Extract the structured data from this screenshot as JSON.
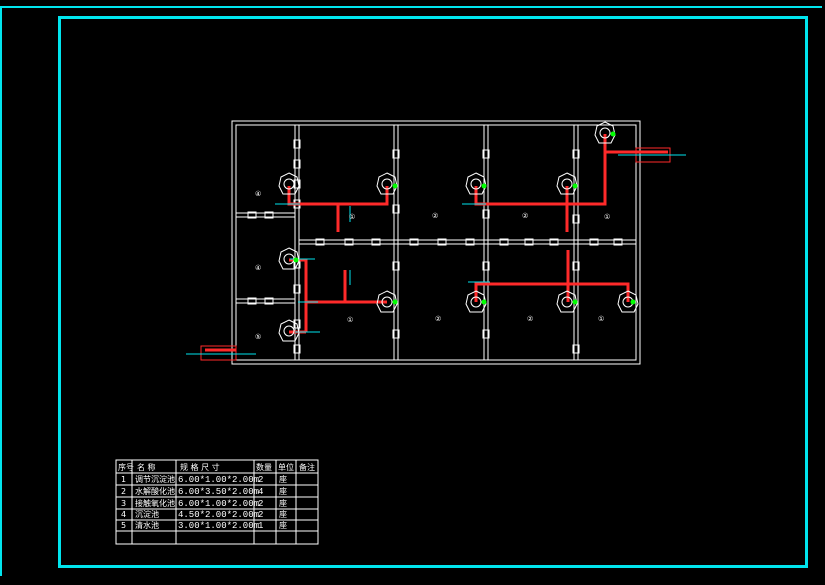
{
  "drawing": {
    "line_color": "#ffffff",
    "frame_color": "#00e5ee",
    "pipe_color": "#ff2a2a",
    "valve_color": "#00ff00",
    "axis_color": "#00e5ee"
  },
  "room_labels": [
    "④",
    "④",
    "⑤",
    "①",
    "②",
    "②",
    "①",
    "①",
    "②",
    "②",
    "①"
  ],
  "table": {
    "headers": [
      "序号",
      "名 称",
      "规 格 尺 寸",
      "数量",
      "单位",
      "备注"
    ],
    "rows": [
      {
        "no": "1",
        "name": "调节沉淀池",
        "spec": "6.00*1.00*2.00m",
        "qty": "2",
        "unit": "座",
        "note": ""
      },
      {
        "no": "2",
        "name": "水解酸化池",
        "spec": "6.00*3.50*2.00m",
        "qty": "4",
        "unit": "座",
        "note": ""
      },
      {
        "no": "3",
        "name": "接触氧化池",
        "spec": "6.00*1.00*2.00m",
        "qty": "2",
        "unit": "座",
        "note": ""
      },
      {
        "no": "4",
        "name": "沉淀池",
        "spec": "4.50*2.00*2.00m",
        "qty": "2",
        "unit": "座",
        "note": ""
      },
      {
        "no": "5",
        "name": "清水池",
        "spec": "3.00*1.00*2.00m",
        "qty": "1",
        "unit": "座",
        "note": ""
      }
    ]
  }
}
